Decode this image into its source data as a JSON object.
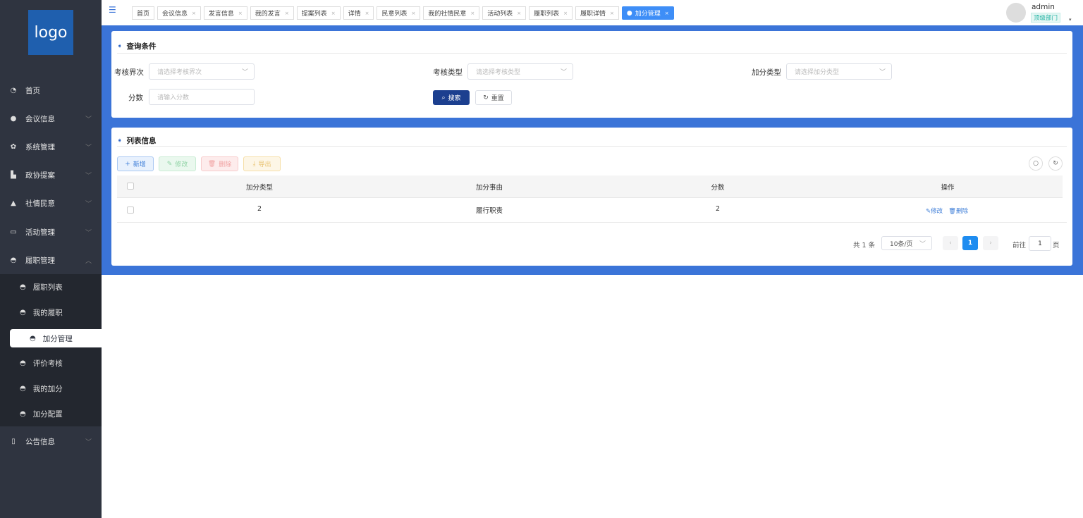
{
  "sidebar": {
    "logo": "logo",
    "items": [
      {
        "label": "首页",
        "icon": "dashboard-icon"
      },
      {
        "label": "会议信息",
        "icon": "users-icon"
      },
      {
        "label": "系统管理",
        "icon": "gear-icon"
      },
      {
        "label": "政协提案",
        "icon": "copy-icon"
      },
      {
        "label": "社情民意",
        "icon": "user-icon"
      },
      {
        "label": "活动管理",
        "icon": "monitor-icon"
      },
      {
        "label": "履职管理",
        "icon": "role-icon"
      }
    ],
    "sub_items": [
      {
        "label": "履职列表"
      },
      {
        "label": "我的履职"
      },
      {
        "label": "加分管理"
      },
      {
        "label": "评价考核"
      },
      {
        "label": "我的加分"
      },
      {
        "label": "加分配置"
      }
    ],
    "last_item": {
      "label": "公告信息",
      "icon": "mobile-icon"
    }
  },
  "header": {
    "tabs": [
      "首页",
      "会议信息",
      "发言信息",
      "我的发言",
      "提案列表",
      "详情",
      "民意列表",
      "我的社情民意",
      "活动列表",
      "履职列表",
      "履职详情",
      "加分管理"
    ],
    "user": "admin",
    "dept": "顶级部门"
  },
  "query": {
    "title": "查询条件",
    "fields": [
      {
        "label": "考核界次",
        "placeholder": "请选择考核界次"
      },
      {
        "label": "考核类型",
        "placeholder": "请选择考核类型"
      },
      {
        "label": "加分类型",
        "placeholder": "请选择加分类型"
      },
      {
        "label": "分数",
        "placeholder": "请输入分数"
      }
    ],
    "search": "搜索",
    "reset": "重置"
  },
  "list": {
    "title": "列表信息",
    "add": "新增",
    "edit": "修改",
    "delete": "删除",
    "export": "导出",
    "columns": [
      "加分类型",
      "加分事由",
      "分数",
      "操作"
    ],
    "rows": [
      {
        "type": "2",
        "reason": "履行职责",
        "score": "2",
        "edit": "修改",
        "delete": "删除"
      }
    ]
  },
  "pagination": {
    "total": "共 1 条",
    "page_size": "10条/页",
    "current": "1",
    "goto_label": "前往",
    "goto_value": "1",
    "page_suffix": "页"
  }
}
